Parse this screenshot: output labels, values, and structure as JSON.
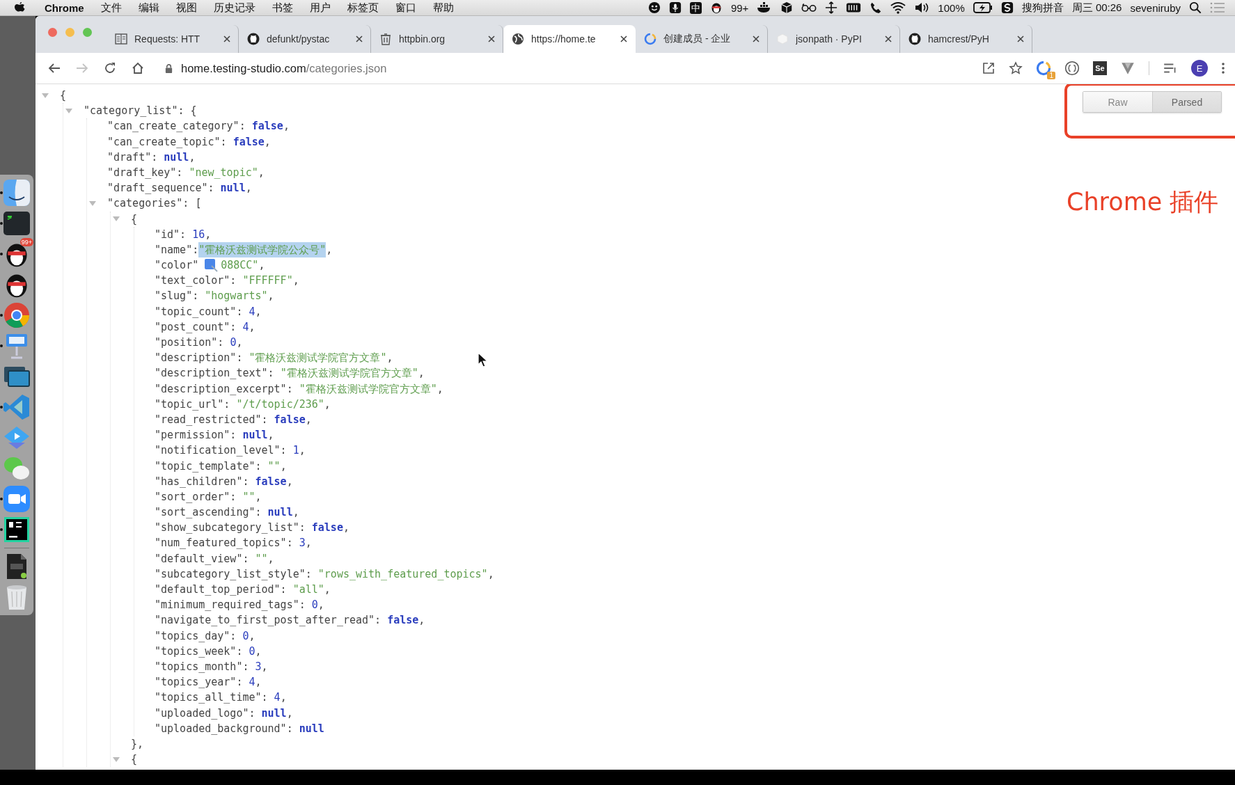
{
  "menu_bar": {
    "app": "Chrome",
    "menus": [
      "文件",
      "编辑",
      "视图",
      "历史记录",
      "书签",
      "用户",
      "标签页",
      "窗口",
      "帮助"
    ],
    "status": [
      {
        "kind": "smiley"
      },
      {
        "kind": "mic"
      },
      {
        "kind": "ime",
        "text": "中"
      },
      {
        "kind": "penguin"
      },
      {
        "kind": "text",
        "text": "99+"
      },
      {
        "kind": "whale"
      },
      {
        "kind": "cube"
      },
      {
        "kind": "glasses"
      },
      {
        "kind": "move"
      },
      {
        "kind": "keyboard"
      },
      {
        "kind": "phone"
      },
      {
        "kind": "wifi"
      },
      {
        "kind": "volume"
      },
      {
        "kind": "text",
        "text": "100%"
      },
      {
        "kind": "battery"
      },
      {
        "kind": "sogou"
      },
      {
        "kind": "text",
        "text": "搜狗拼音"
      },
      {
        "kind": "text",
        "text": "周三 00:26"
      },
      {
        "kind": "text",
        "text": "seveniruby"
      },
      {
        "kind": "search"
      },
      {
        "kind": "list"
      }
    ]
  },
  "dock": [
    {
      "kind": "finder",
      "running": true
    },
    {
      "kind": "terminal",
      "running": true
    },
    {
      "kind": "penguin",
      "running": true,
      "badge": "99+"
    },
    {
      "kind": "penguin",
      "running": false
    },
    {
      "kind": "chrome",
      "running": true
    },
    {
      "kind": "keynote",
      "running": true
    },
    {
      "kind": "screens",
      "running": false
    },
    {
      "kind": "vscode",
      "running": true
    },
    {
      "kind": "classroom",
      "running": false
    },
    {
      "kind": "wechat",
      "running": false
    },
    {
      "kind": "zoom",
      "running": true
    },
    {
      "kind": "pycharm",
      "running": true
    },
    {
      "kind": "apk",
      "running": false
    },
    {
      "kind": "trash",
      "running": false
    }
  ],
  "browser": {
    "tabs": [
      {
        "kind": "doc",
        "title": "Requests: HTT",
        "selected": false
      },
      {
        "kind": "github",
        "title": "defunkt/pystac",
        "selected": false
      },
      {
        "kind": "bin",
        "title": "httpbin.org",
        "selected": false
      },
      {
        "kind": "globe",
        "title": "https://home.te",
        "selected": true
      },
      {
        "kind": "ring",
        "title": "创建成员 - 企业",
        "selected": false
      },
      {
        "kind": "blank",
        "title": "jsonpath · PyPI",
        "selected": false
      },
      {
        "kind": "github",
        "title": "hamcrest/PyH",
        "selected": false
      }
    ],
    "toolbar": {
      "forward_disabled": true,
      "url_host": "home.testing-studio.com",
      "url_path": "/categories.json",
      "extensions": [
        {
          "kind": "ring",
          "badge": "1"
        },
        {
          "kind": "braces"
        },
        {
          "kind": "se",
          "label": "Se"
        },
        {
          "kind": "vee"
        },
        {
          "kind": "playlist"
        }
      ],
      "avatar": "E"
    }
  },
  "viewer": {
    "tree": {
      "kind": "object",
      "open": "{",
      "expanded": true,
      "children": [
        {
          "kind": "object",
          "open": "\"category_list\": {",
          "expanded": true,
          "children": [
            {
              "key": "\"can_create_category\": ",
              "value": "false",
              "kind": "literal",
              "end": ","
            },
            {
              "key": "\"can_create_topic\": ",
              "value": "false",
              "kind": "literal",
              "end": ","
            },
            {
              "key": "\"draft\": ",
              "value": "null",
              "kind": "literal",
              "end": ","
            },
            {
              "key": "\"draft_key\": ",
              "value": "\"new_topic\"",
              "kind": "string",
              "end": ","
            },
            {
              "key": "\"draft_sequence\": ",
              "value": "null",
              "kind": "literal",
              "end": ","
            },
            {
              "kind": "object",
              "open": "\"categories\": [",
              "expanded": true,
              "children": [
                {
                  "kind": "object",
                  "open": "{",
                  "expanded": true,
                  "close": "},",
                  "children": [
                    {
                      "key": "\"id\": ",
                      "value": "16",
                      "kind": "number",
                      "end": ","
                    },
                    {
                      "key": "\"name\": ",
                      "value": "\"霍格沃兹测试学院公众号\"",
                      "kind": "string",
                      "end": ",",
                      "highlighted": true
                    },
                    {
                      "key": "\"color\"",
                      "value": "088CC\"",
                      "kind": "string",
                      "end": ",",
                      "covered": true
                    },
                    {
                      "key": "\"text_color\": ",
                      "value": "\"FFFFFF\"",
                      "kind": "string",
                      "end": ","
                    },
                    {
                      "key": "\"slug\": ",
                      "value": "\"hogwarts\"",
                      "kind": "string",
                      "end": ","
                    },
                    {
                      "key": "\"topic_count\": ",
                      "value": "4",
                      "kind": "number",
                      "end": ","
                    },
                    {
                      "key": "\"post_count\": ",
                      "value": "4",
                      "kind": "number",
                      "end": ","
                    },
                    {
                      "key": "\"position\": ",
                      "value": "0",
                      "kind": "number",
                      "end": ","
                    },
                    {
                      "key": "\"description\": ",
                      "value": "\"霍格沃兹测试学院官方文章\"",
                      "kind": "string",
                      "end": ","
                    },
                    {
                      "key": "\"description_text\": ",
                      "value": "\"霍格沃兹测试学院官方文章\"",
                      "kind": "string",
                      "end": ","
                    },
                    {
                      "key": "\"description_excerpt\": ",
                      "value": "\"霍格沃兹测试学院官方文章\"",
                      "kind": "string",
                      "end": ","
                    },
                    {
                      "key": "\"topic_url\": ",
                      "value": "\"/t/topic/236\"",
                      "kind": "string",
                      "end": ","
                    },
                    {
                      "key": "\"read_restricted\": ",
                      "value": "false",
                      "kind": "literal",
                      "end": ","
                    },
                    {
                      "key": "\"permission\": ",
                      "value": "null",
                      "kind": "literal",
                      "end": ","
                    },
                    {
                      "key": "\"notification_level\": ",
                      "value": "1",
                      "kind": "number",
                      "end": ","
                    },
                    {
                      "key": "\"topic_template\": ",
                      "value": "\"\"",
                      "kind": "string",
                      "end": ","
                    },
                    {
                      "key": "\"has_children\": ",
                      "value": "false",
                      "kind": "literal",
                      "end": ","
                    },
                    {
                      "key": "\"sort_order\": ",
                      "value": "\"\"",
                      "kind": "string",
                      "end": ","
                    },
                    {
                      "key": "\"sort_ascending\": ",
                      "value": "null",
                      "kind": "literal",
                      "end": ","
                    },
                    {
                      "key": "\"show_subcategory_list\": ",
                      "value": "false",
                      "kind": "literal",
                      "end": ","
                    },
                    {
                      "key": "\"num_featured_topics\": ",
                      "value": "3",
                      "kind": "number",
                      "end": ","
                    },
                    {
                      "key": "\"default_view\": ",
                      "value": "\"\"",
                      "kind": "string",
                      "end": ","
                    },
                    {
                      "key": "\"subcategory_list_style\": ",
                      "value": "\"rows_with_featured_topics\"",
                      "kind": "string",
                      "end": ","
                    },
                    {
                      "key": "\"default_top_period\": ",
                      "value": "\"all\"",
                      "kind": "string",
                      "end": ","
                    },
                    {
                      "key": "\"minimum_required_tags\": ",
                      "value": "0",
                      "kind": "number",
                      "end": ","
                    },
                    {
                      "key": "\"navigate_to_first_post_after_read\": ",
                      "value": "false",
                      "kind": "literal",
                      "end": ","
                    },
                    {
                      "key": "\"topics_day\": ",
                      "value": "0",
                      "kind": "number",
                      "end": ","
                    },
                    {
                      "key": "\"topics_week\": ",
                      "value": "0",
                      "kind": "number",
                      "end": ","
                    },
                    {
                      "key": "\"topics_month\": ",
                      "value": "3",
                      "kind": "number",
                      "end": ","
                    },
                    {
                      "key": "\"topics_year\": ",
                      "value": "4",
                      "kind": "number",
                      "end": ","
                    },
                    {
                      "key": "\"topics_all_time\": ",
                      "value": "4",
                      "kind": "number",
                      "end": ","
                    },
                    {
                      "key": "\"uploaded_logo\": ",
                      "value": "null",
                      "kind": "literal",
                      "end": ","
                    },
                    {
                      "key": "\"uploaded_background\": ",
                      "value": "null",
                      "kind": "literal"
                    }
                  ]
                },
                {
                  "kind": "object",
                  "open": "{",
                  "expanded": true
                }
              ]
            }
          ]
        }
      ]
    },
    "toggle": [
      {
        "label": "Raw",
        "selected": false
      },
      {
        "label": "Parsed",
        "selected": true
      }
    ]
  },
  "annotation": {
    "text": "Chrome 插件"
  }
}
